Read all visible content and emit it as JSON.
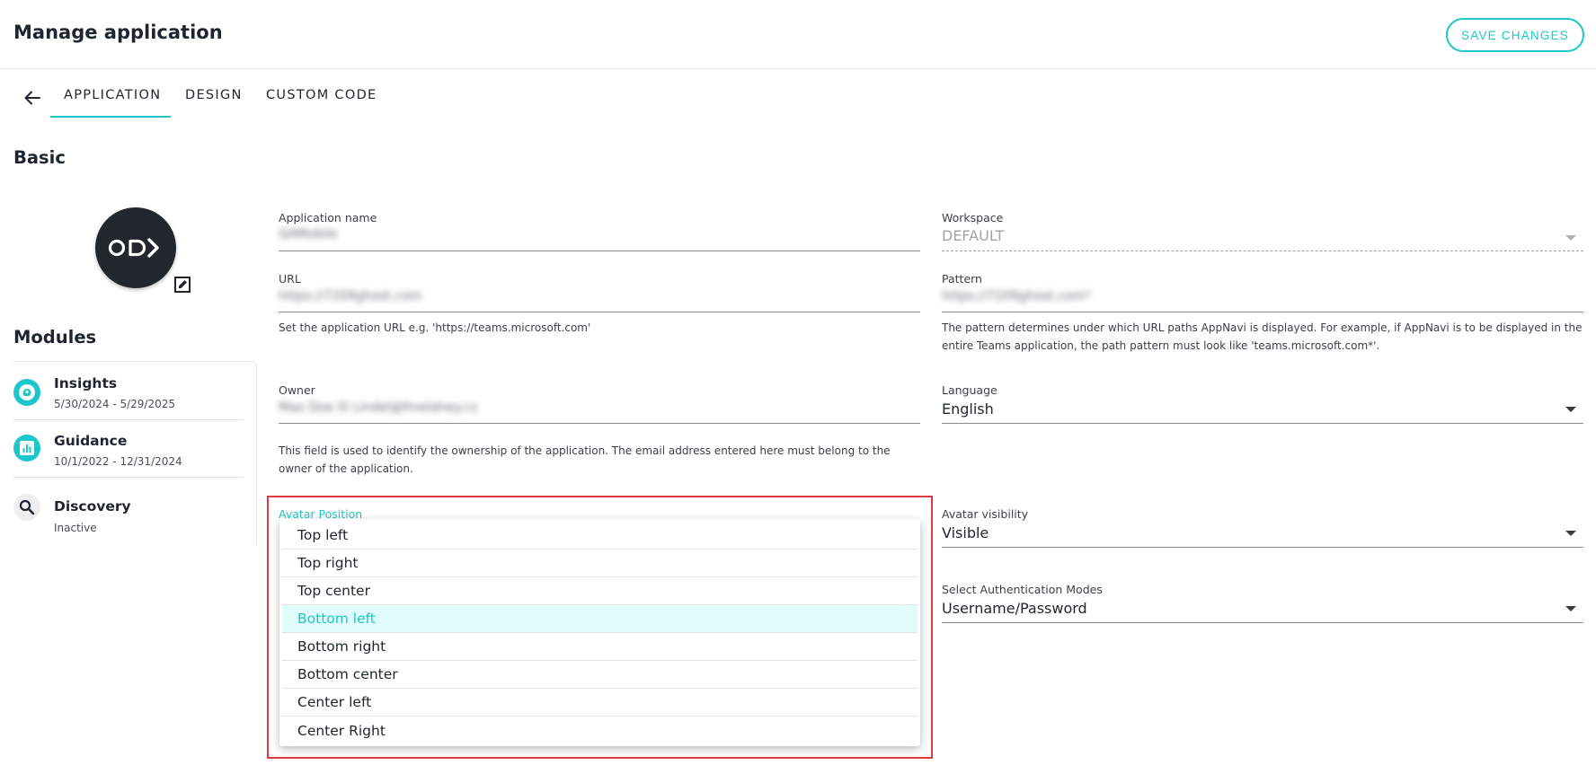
{
  "header": {
    "title": "Manage application",
    "save_label": "SAVE CHANGES"
  },
  "tabs": [
    {
      "label": "APPLICATION",
      "active": true
    },
    {
      "label": "DESIGN",
      "active": false
    },
    {
      "label": "CUSTOM CODE",
      "active": false
    }
  ],
  "sections": {
    "basic": "Basic",
    "modules": "Modules"
  },
  "modules": [
    {
      "name": "Insights",
      "date": "5/30/2024 - 5/29/2025",
      "icon": "insights-icon"
    },
    {
      "name": "Guidance",
      "date": "10/1/2022 - 12/31/2024",
      "icon": "chart-icon"
    },
    {
      "name": "Discovery",
      "date": "Inactive",
      "icon": "search-icon"
    }
  ],
  "form": {
    "app_name": {
      "label": "Application name",
      "value": "Q4Mobile"
    },
    "workspace": {
      "label": "Workspace",
      "value": "DEFAULT"
    },
    "url": {
      "label": "URL",
      "value": "https://7209ghost.com",
      "helper": "Set the application URL e.g. 'https://teams.microsoft.com'"
    },
    "pattern": {
      "label": "Pattern",
      "value": "https://7209ghost.com*",
      "helper": "The pattern determines under which URL paths AppNavi is displayed. For example, if AppNavi is to be displayed in the entire Teams application, the path pattern must look like 'teams.microsoft.com*'."
    },
    "owner": {
      "label": "Owner",
      "value": "Max Doe Ill Lindel@fmeldney.cz",
      "helper": "This field is used to identify the ownership of the application. The email address entered here must belong to the owner of the application."
    },
    "language": {
      "label": "Language",
      "value": "English"
    },
    "avatar_position": {
      "label": "Avatar Position"
    },
    "avatar_visibility": {
      "label": "Avatar visibility",
      "value": "Visible"
    },
    "auth_modes": {
      "label": "Select Authentication Modes",
      "value": "Username/Password"
    }
  },
  "dropdown": {
    "options": [
      "Top left",
      "Top right",
      "Top center",
      "Bottom left",
      "Bottom right",
      "Bottom center",
      "Center left",
      "Center Right"
    ],
    "selected": "Bottom left"
  },
  "colors": {
    "accent": "#1cc7c9",
    "highlight_border": "#e0393e",
    "selected_bg": "#e2fbfb"
  }
}
